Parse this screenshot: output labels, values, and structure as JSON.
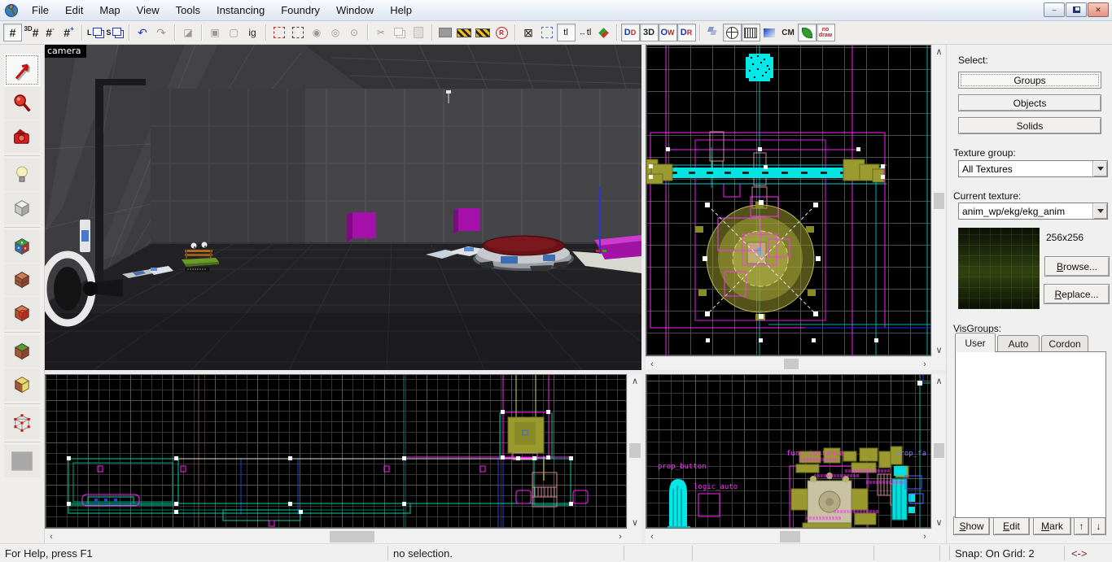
{
  "menu": {
    "items": [
      "File",
      "Edit",
      "Map",
      "View",
      "Tools",
      "Instancing",
      "Foundry",
      "Window",
      "Help"
    ]
  },
  "window_controls": {
    "minimize": "–",
    "close": "✕"
  },
  "toolbar": {
    "hash": "#",
    "grid3d": "3D",
    "minus": "-",
    "plus": "+",
    "load": "L",
    "save": "S",
    "undo": "↶",
    "redo": "↷",
    "carve": "◪",
    "group": "▣",
    "ungroup": "▢",
    "ig": "ig",
    "circle1": "◉",
    "circle2": "◎",
    "circle3": "⊙",
    "cut": "✂",
    "r": "R",
    "selbox": "⊠",
    "tl": "tl",
    "tl2": "tl",
    "arrows": "↔",
    "dd": [
      "D",
      "D"
    ],
    "tree": "3D",
    "ow": [
      "O",
      "W"
    ],
    "dr": [
      "D",
      "R"
    ],
    "cm": "CM",
    "nodraw": [
      "no",
      "draw"
    ]
  },
  "viewports": {
    "camera_label": "camera",
    "front_labels": [
      "prop_button",
      "logic_auto",
      "func_instance",
      "prop_fa"
    ]
  },
  "right_panel": {
    "select_label": "Select:",
    "select_buttons": [
      "Groups",
      "Objects",
      "Solids"
    ],
    "texture_group_label": "Texture group:",
    "texture_group_value": "All Textures",
    "current_texture_label": "Current texture:",
    "current_texture_value": "anim_wp/ekg/ekg_anim",
    "texture_size": "256x256",
    "browse_label": "Browse...",
    "replace_label": "Replace...",
    "visgroups_label": "VisGroups:",
    "visgroup_tabs": [
      "User",
      "Auto",
      "Cordon"
    ],
    "show_label": "Show",
    "edit_label": "Edit",
    "mark_label": "Mark",
    "up_icon": "↑",
    "down_icon": "↓"
  },
  "status_bar": {
    "help_text": "For Help, press F1",
    "selection_text": "no selection.",
    "snap_text": "Snap: On Grid: 2",
    "coords_text": "<->"
  }
}
